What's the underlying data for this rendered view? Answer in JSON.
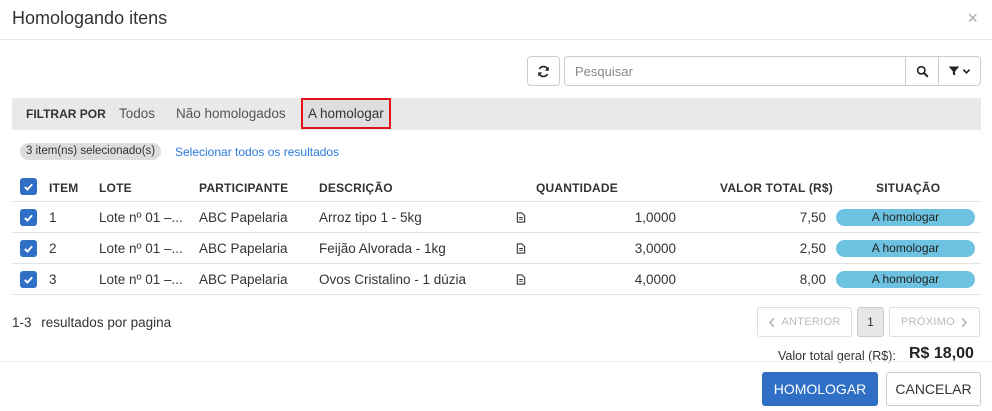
{
  "dialog": {
    "title": "Homologando itens",
    "close_glyph": "×"
  },
  "toolbar": {
    "refresh_icon": "refresh-icon",
    "search_placeholder": "Pesquisar",
    "search_value": "",
    "search_icon": "search-icon",
    "filter_icon": "filter-icon"
  },
  "filter": {
    "label": "FILTRAR POR",
    "options": [
      {
        "label": "Todos",
        "active": false
      },
      {
        "label": "Não homologados",
        "active": false
      },
      {
        "label": "A homologar",
        "active": true
      }
    ]
  },
  "selection": {
    "badge": "3 item(ns) selecionado(s)",
    "select_all_link": "Selecionar todos os resultados"
  },
  "table": {
    "headers": [
      "ITEM",
      "LOTE",
      "PARTICIPANTE",
      "DESCRIÇÃO",
      "QUANTIDADE",
      "VALOR TOTAL (R$)",
      "SITUAÇÃO"
    ],
    "rows": [
      {
        "checked": true,
        "item": "1",
        "lote": "Lote nº 01 –...",
        "participante": "ABC Papelaria",
        "descricao": "Arroz tipo 1 - 5kg",
        "quantidade": "1,0000",
        "valor": "7,50",
        "situacao": "A homologar"
      },
      {
        "checked": true,
        "item": "2",
        "lote": "Lote nº 01 –...",
        "participante": "ABC Papelaria",
        "descricao": "Feijão Alvorada - 1kg",
        "quantidade": "3,0000",
        "valor": "2,50",
        "situacao": "A homologar"
      },
      {
        "checked": true,
        "item": "3",
        "lote": "Lote nº 01 –...",
        "participante": "ABC Papelaria",
        "descricao": "Ovos Cristalino - 1 dúzia",
        "quantidade": "4,0000",
        "valor": "8,00",
        "situacao": "A homologar"
      }
    ]
  },
  "pagination": {
    "range": "1-3",
    "per_page_label": "resultados por pagina",
    "prev_label": "ANTERIOR",
    "page": "1",
    "next_label": "PRÓXIMO"
  },
  "summary": {
    "total_label": "Valor total geral (R$):",
    "total_value": "R$ 18,00"
  },
  "actions": {
    "primary_label": "HOMOLOGAR",
    "cancel_label": "CANCELAR"
  },
  "colors": {
    "primary": "#2f6fc6",
    "status": "#6cc2e0",
    "highlight": "#e0121a",
    "link": "#2a7ae2"
  }
}
